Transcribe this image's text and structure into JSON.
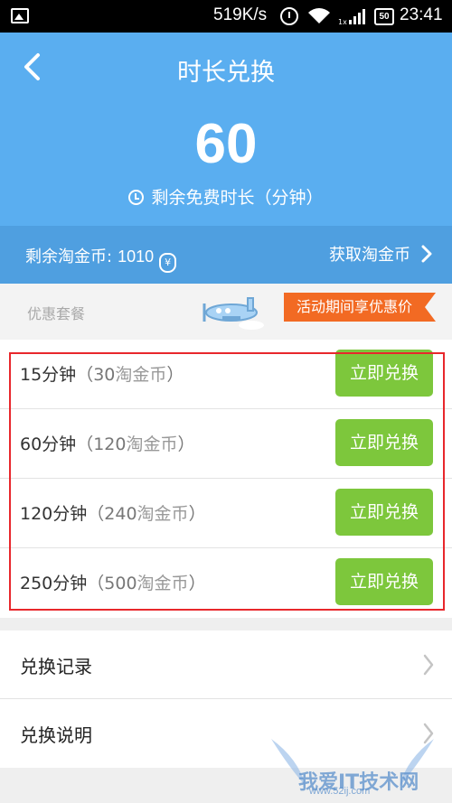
{
  "status_bar": {
    "net_speed": "519K/s",
    "battery": "50",
    "time": "23:41"
  },
  "header": {
    "title": "时长兑换",
    "remaining_minutes": "60",
    "remaining_label": "剩余免费时长（分钟）"
  },
  "coins": {
    "label": "剩余淘金币:",
    "value": "1010",
    "bag_symbol": "¥",
    "get_link": "获取淘金币"
  },
  "promo": {
    "section_label": "优惠套餐",
    "ribbon_text": "活动期间享优惠价"
  },
  "packages": [
    {
      "duration": "15分钟",
      "open": "（",
      "cost": "30",
      "unit": "淘金币",
      "close": "）",
      "button": "立即兑换"
    },
    {
      "duration": "60分钟",
      "open": "（",
      "cost": "120",
      "unit": "淘金币",
      "close": "）",
      "button": "立即兑换"
    },
    {
      "duration": "120分钟",
      "open": "（",
      "cost": "240",
      "unit": "淘金币",
      "close": "）",
      "button": "立即兑换"
    },
    {
      "duration": "250分钟",
      "open": "（",
      "cost": "500",
      "unit": "淘金币",
      "close": "）",
      "button": "立即兑换"
    }
  ],
  "menu": [
    {
      "label": "兑换记录"
    },
    {
      "label": "兑换说明"
    }
  ],
  "watermark": {
    "text": "我爱IT技术网",
    "url": "www.52ij.com"
  },
  "colors": {
    "header_blue": "#5aaef0",
    "coinbar_blue": "#4f9fe0",
    "button_green": "#7dc73c",
    "promo_orange": "#f26a23",
    "highlight_red": "#e8272c"
  }
}
